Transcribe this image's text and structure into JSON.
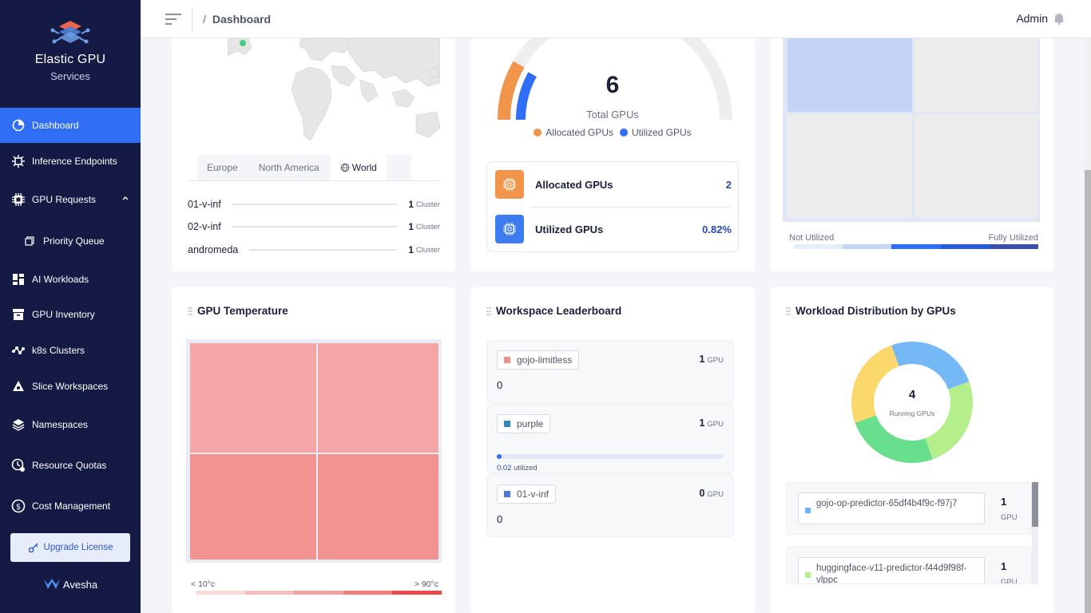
{
  "app": {
    "title": "Elastic GPU",
    "subtitle": "Services",
    "brand": "Avesha"
  },
  "colors": {
    "sidebar": "#141a44",
    "accent": "#2f6ef5",
    "allocated": "#f0954a",
    "utilized": "#2f6ef5"
  },
  "sidebar": {
    "items": [
      {
        "label": "Dashboard",
        "icon": "pie-chart-icon",
        "active": true
      },
      {
        "label": "Inference Endpoints",
        "icon": "chip-gear-icon"
      },
      {
        "label": "GPU Requests",
        "icon": "gpu-chip-icon"
      },
      {
        "label": "Priority Queue",
        "icon": "queue-icon"
      },
      {
        "label": "AI Workloads",
        "icon": "workloads-icon"
      },
      {
        "label": "GPU Inventory",
        "icon": "inventory-box-icon"
      },
      {
        "label": "k8s Clusters",
        "icon": "cluster-nodes-icon"
      },
      {
        "label": "Slice Workspaces",
        "icon": "workspace-icon"
      },
      {
        "label": "Namespaces",
        "icon": "layers-icon"
      },
      {
        "label": "Resource Quotas",
        "icon": "quota-clock-icon"
      },
      {
        "label": "Cost Management",
        "icon": "cost-coin-icon"
      }
    ],
    "upgrade_label": "Upgrade License"
  },
  "header": {
    "breadcrumb_sep": "/",
    "breadcrumb": "Dashboard",
    "user": "Admin"
  },
  "map": {
    "tabs": [
      "Europe",
      "North America",
      "World"
    ],
    "selected_tab": "World",
    "clusters": [
      {
        "name": "01-v-inf",
        "count": "1",
        "unit": "Cluster"
      },
      {
        "name": "02-v-inf",
        "count": "1",
        "unit": "Cluster"
      },
      {
        "name": "andromeda",
        "count": "1",
        "unit": "Cluster"
      }
    ]
  },
  "gpus": {
    "total": "6",
    "total_label": "Total GPUs",
    "legend_allocated": "Allocated GPUs",
    "legend_utilized": "Utilized GPUs",
    "allocated_fraction": 0.333,
    "utilized_fraction": 0.0082,
    "stats": [
      {
        "label": "Allocated GPUs",
        "value": "2"
      },
      {
        "label": "Utilized GPUs",
        "value": "0.82%"
      }
    ]
  },
  "utilization": {
    "legend_low": "Not Utilized",
    "legend_high": "Fully Utilized"
  },
  "temperature": {
    "title": "GPU Temperature",
    "legend_low": "< 10°c",
    "legend_high": "> 90°c"
  },
  "leaderboard": {
    "title": "Workspace Leaderboard",
    "items": [
      {
        "name": "gojo-limitless",
        "gpus": "1",
        "unit": "GPU",
        "value": "0",
        "color": "#f08f87"
      },
      {
        "name": "purple",
        "gpus": "1",
        "unit": "GPU",
        "utilized": "0.02",
        "utilized_label": "utilized",
        "color": "#2e8bbd"
      },
      {
        "name": "01-v-inf",
        "gpus": "0",
        "unit": "GPU",
        "value": "0",
        "color": "#4a78e0"
      }
    ]
  },
  "distribution": {
    "title": "Workload Distribution by GPUs",
    "count": "4",
    "count_label": "Running GPUs",
    "items": [
      {
        "name": "gojo-op-predictor-65df4b4f9c-f97j7",
        "gpus": "1",
        "unit": "GPU",
        "color": "#6cb4f5"
      },
      {
        "name": "huggingface-v11-predictor-f44d9f98f-vlppc",
        "gpus": "1",
        "unit": "GPU",
        "color": "#b4ef8c"
      }
    ]
  }
}
